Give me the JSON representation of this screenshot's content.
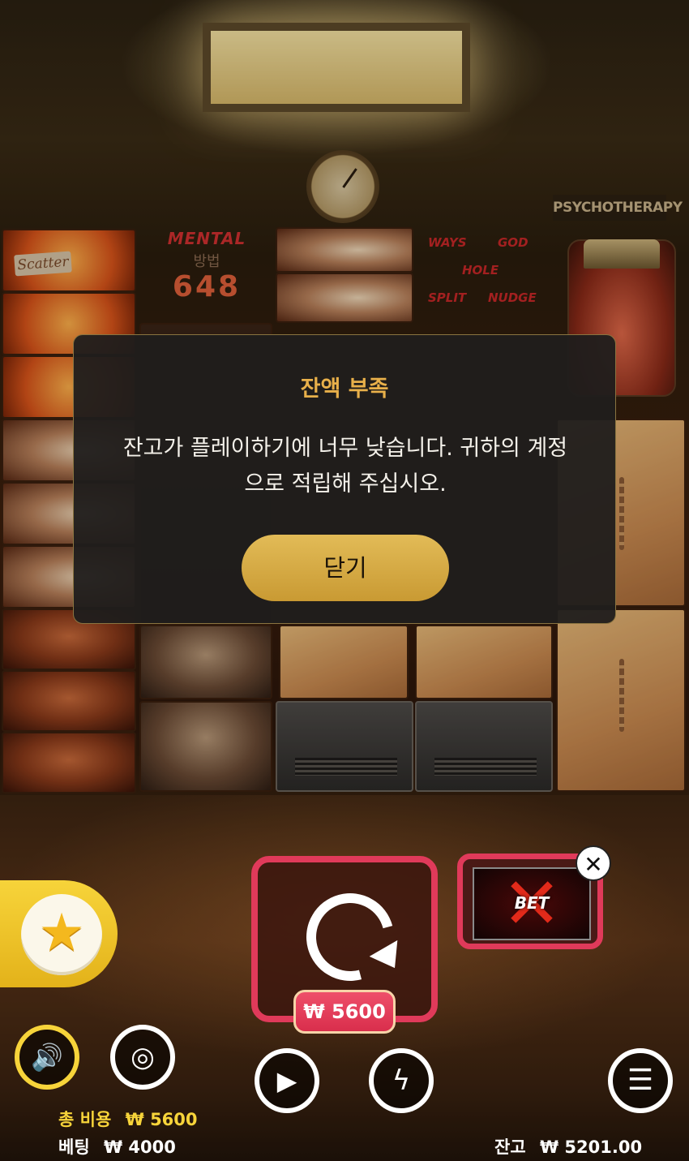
{
  "background": {
    "sign_text": "PSYCHOTHERAPY",
    "meter": {
      "title": "MENTAL",
      "subtitle": "방법",
      "value": "648"
    },
    "feature_words": [
      "WAYS",
      "GOD",
      "HOLE",
      "SPLIT",
      "NUDGE"
    ],
    "scatter_label": "Scatter"
  },
  "modal": {
    "title": "잔액 부족",
    "message_line1": "잔고가 플레이하기에 너무 낮습니다. 귀하의 계정",
    "message_line2": "으로 적립해 주십시오.",
    "close_label": "닫기"
  },
  "controls": {
    "spin_cost": "₩ 5600",
    "bet_feature": "BET",
    "close_symbol": "✕"
  },
  "stats": {
    "total_cost_label": "총 비용",
    "total_cost_value": "₩ 5600",
    "bet_label": "베팅",
    "bet_value": "₩ 4000",
    "balance_label": "잔고",
    "balance_value": "₩ 5201.00"
  },
  "colors": {
    "accent": "#e2bb57",
    "spin_border": "#e03a5a",
    "fav": "#f7d43a"
  },
  "icons": [
    "star-icon",
    "spin-icon",
    "sound-icon",
    "coin-icon",
    "play-icon",
    "lightning-icon",
    "menu-icon",
    "close-icon"
  ]
}
